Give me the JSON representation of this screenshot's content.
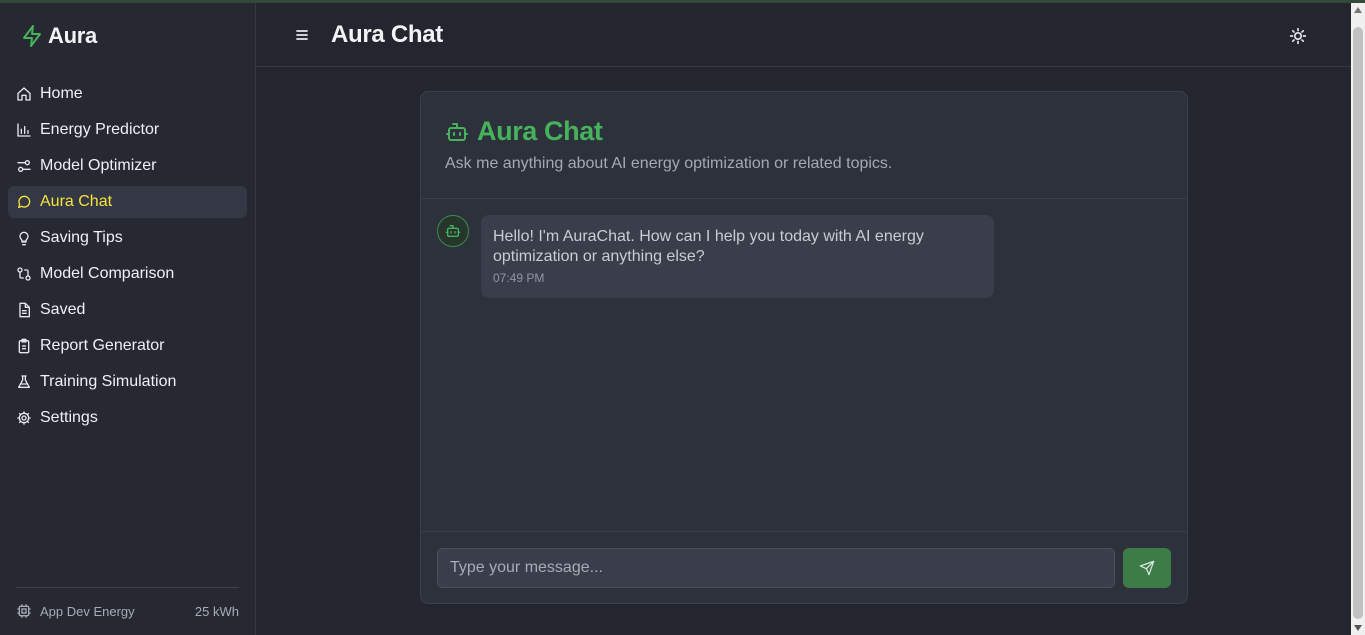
{
  "brand": {
    "name": "Aura",
    "icon": "lightning-bolt-icon",
    "accent": "#47b25c"
  },
  "sidebar": {
    "items": [
      {
        "label": "Home",
        "icon": "home-icon",
        "active": false
      },
      {
        "label": "Energy Predictor",
        "icon": "bar-chart-icon",
        "active": false
      },
      {
        "label": "Model Optimizer",
        "icon": "sliders-icon",
        "active": false
      },
      {
        "label": "Aura Chat",
        "icon": "message-circle-icon",
        "active": true
      },
      {
        "label": "Saving Tips",
        "icon": "lightbulb-icon",
        "active": false
      },
      {
        "label": "Model Comparison",
        "icon": "compare-arrows-icon",
        "active": false
      },
      {
        "label": "Saved",
        "icon": "file-icon",
        "active": false
      },
      {
        "label": "Report Generator",
        "icon": "clipboard-icon",
        "active": false
      },
      {
        "label": "Training Simulation",
        "icon": "flask-icon",
        "active": false
      },
      {
        "label": "Settings",
        "icon": "gear-icon",
        "active": false
      }
    ],
    "active_color": "#f5e43c",
    "footer": {
      "label": "App Dev Energy",
      "value": "25 kWh",
      "icon": "cpu-icon"
    }
  },
  "header": {
    "title": "Aura Chat",
    "menu_icon": "hamburger-menu-icon",
    "theme_icon": "sun-icon"
  },
  "chat": {
    "title": "Aura Chat",
    "subtitle": "Ask me anything about AI energy optimization or related topics.",
    "title_icon": "bot-icon",
    "messages": [
      {
        "sender": "bot",
        "text": "Hello! I'm AuraChat. How can I help you today with AI energy optimization or anything else?",
        "time": "07:49 PM"
      }
    ],
    "input_placeholder": "Type your message...",
    "input_value": "",
    "send_icon": "send-icon",
    "send_color": "#3d7b47"
  }
}
